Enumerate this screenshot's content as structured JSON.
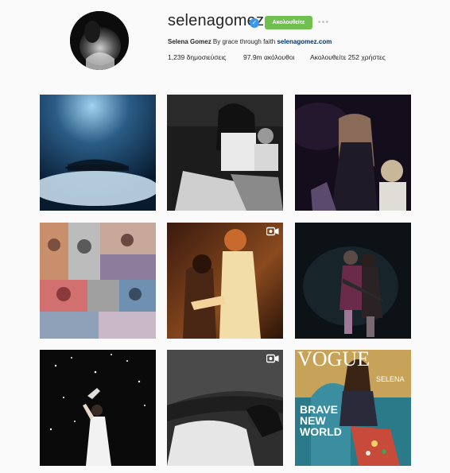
{
  "profile": {
    "username": "selenagomez",
    "follow_label": "Ακολουθείτε",
    "bio_name": "Selena Gomez",
    "bio_text": "By grace through faith",
    "bio_link": "selenagomez.com",
    "posts": "1,239 δημοσιεύσεις",
    "followers": "97.9m ακόλουθοι",
    "following": "Ακολουθείτε 252 χρήστες"
  },
  "posts": [
    {
      "type": "photo"
    },
    {
      "type": "photo"
    },
    {
      "type": "photo"
    },
    {
      "type": "photo"
    },
    {
      "type": "video"
    },
    {
      "type": "photo"
    },
    {
      "type": "photo"
    },
    {
      "type": "video"
    },
    {
      "type": "photo"
    }
  ],
  "magazine": {
    "masthead": "VOGUE",
    "cover_lines": [
      "BRAVE",
      "NEW",
      "WORLD"
    ],
    "name": "SELENA"
  },
  "colors": {
    "verified": "#3897f0",
    "follow_button": "#70c050",
    "link": "#003569",
    "background": "#fafafa"
  },
  "icons": {
    "verified": "verified-badge-icon",
    "more": "more-options-icon",
    "video": "video-camera-icon"
  }
}
